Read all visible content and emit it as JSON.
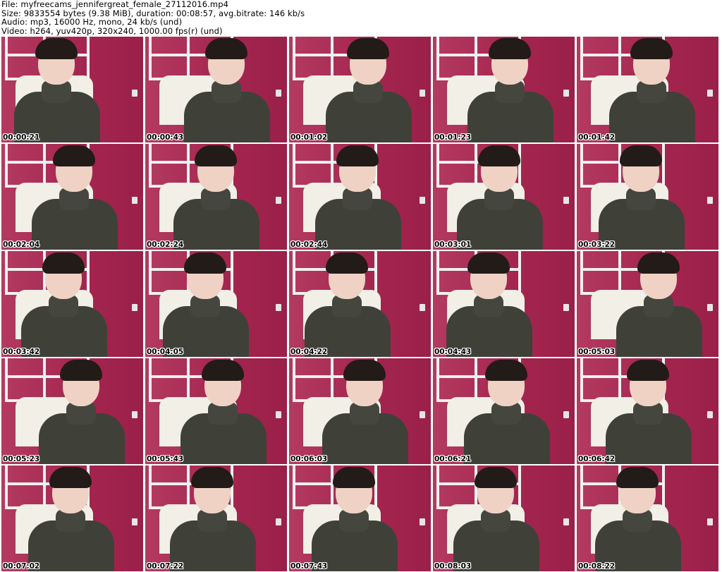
{
  "header": {
    "file_line": "File: myfreecams_jennifergreat_female_27112016.mp4",
    "size_line": "Size: 9833554 bytes (9.38 MiB), duration: 00:08:57, avg.bitrate: 146 kb/s",
    "audio_line": "Audio: mp3, 16000 Hz, mono, 24 kb/s (und)",
    "video_line": "Video: h264, yuv420p, 320x240, 1000.00 fps(r) (und)"
  },
  "thumbnails": [
    {
      "timestamp": "00:00:21"
    },
    {
      "timestamp": "00:00:43"
    },
    {
      "timestamp": "00:01:02"
    },
    {
      "timestamp": "00:01:23"
    },
    {
      "timestamp": "00:01:42"
    },
    {
      "timestamp": "00:02:04"
    },
    {
      "timestamp": "00:02:24"
    },
    {
      "timestamp": "00:02:44"
    },
    {
      "timestamp": "00:03:01"
    },
    {
      "timestamp": "00:03:22"
    },
    {
      "timestamp": "00:03:42"
    },
    {
      "timestamp": "00:04:05"
    },
    {
      "timestamp": "00:04:22"
    },
    {
      "timestamp": "00:04:43"
    },
    {
      "timestamp": "00:05:03"
    },
    {
      "timestamp": "00:05:23"
    },
    {
      "timestamp": "00:05:43"
    },
    {
      "timestamp": "00:06:03"
    },
    {
      "timestamp": "00:06:21"
    },
    {
      "timestamp": "00:06:42"
    },
    {
      "timestamp": "00:07:02"
    },
    {
      "timestamp": "00:07:22"
    },
    {
      "timestamp": "00:07:43"
    },
    {
      "timestamp": "00:08:03"
    },
    {
      "timestamp": "00:08:22"
    }
  ]
}
